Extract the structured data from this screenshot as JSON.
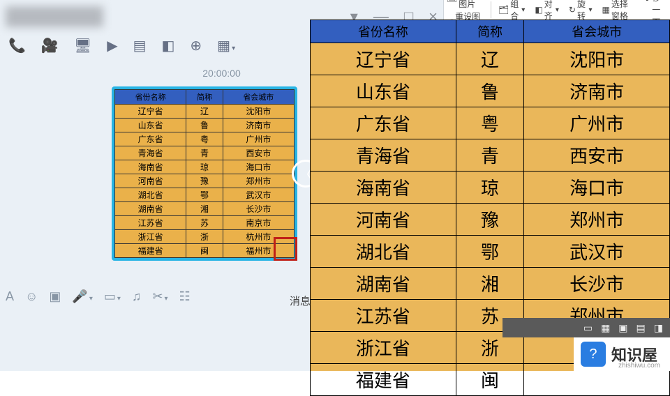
{
  "chat": {
    "user_name": "联系人",
    "window_controls": {
      "dropdown": "▾",
      "min": "—",
      "max": "□",
      "close": "×"
    },
    "toolbar": [
      "phone-icon",
      "video-icon",
      "screen-share-icon",
      "send-file-icon",
      "send-image-icon",
      "app-icon",
      "add-icon",
      "grid-icon"
    ],
    "timestamp": "20:00:00",
    "mini_table": {
      "headers": [
        "省份名称",
        "简称",
        "省会城市"
      ],
      "rows": [
        [
          "辽宁省",
          "辽",
          "沈阳市"
        ],
        [
          "山东省",
          "鲁",
          "济南市"
        ],
        [
          "广东省",
          "粤",
          "广州市"
        ],
        [
          "青海省",
          "青",
          "西安市"
        ],
        [
          "海南省",
          "琼",
          "海口市"
        ],
        [
          "河南省",
          "豫",
          "郑州市"
        ],
        [
          "湖北省",
          "鄂",
          "武汉市"
        ],
        [
          "湖南省",
          "湘",
          "长沙市"
        ],
        [
          "江苏省",
          "苏",
          "南京市"
        ],
        [
          "浙江省",
          "浙",
          "杭州市"
        ],
        [
          "福建省",
          "闽",
          "福州市"
        ]
      ]
    },
    "input_bar": [
      "font-icon",
      "emoji-icon",
      "image-icon",
      "mic-icon",
      "screenshot-icon",
      "music-icon",
      "cut-icon",
      "history-icon"
    ],
    "msg_label": "消息"
  },
  "ribbon": [
    {
      "icon": "🖼",
      "label": "更改图片",
      "caret": true
    },
    {
      "icon": "↺",
      "label": "重设图片"
    },
    {
      "icon": "🗂",
      "label": "组合",
      "caret": true
    },
    {
      "icon": "◧",
      "label": "对齐",
      "caret": true
    },
    {
      "icon": "↻",
      "label": "旋转",
      "caret": true
    },
    {
      "icon": "▦",
      "label": "选择窗格"
    },
    {
      "icon": "⬆",
      "label": "上移一"
    },
    {
      "icon": "⬇",
      "label": "下移"
    }
  ],
  "big_table": {
    "headers": [
      "省份名称",
      "简称",
      "省会城市"
    ],
    "rows": [
      [
        "辽宁省",
        "辽",
        "沈阳市"
      ],
      [
        "山东省",
        "鲁",
        "济南市"
      ],
      [
        "广东省",
        "粤",
        "广州市"
      ],
      [
        "青海省",
        "青",
        "西安市"
      ],
      [
        "海南省",
        "琼",
        "海口市"
      ],
      [
        "河南省",
        "豫",
        "郑州市"
      ],
      [
        "湖北省",
        "鄂",
        "武汉市"
      ],
      [
        "湖南省",
        "湘",
        "长沙市"
      ],
      [
        "江苏省",
        "苏",
        "郑州市"
      ],
      [
        "浙江省",
        "浙",
        ""
      ],
      [
        "福建省",
        "闽",
        ""
      ]
    ]
  },
  "brand": {
    "name": "知识屋",
    "url": "zhishiwu.com",
    "glyph": "?"
  },
  "pptbar": [
    "▭",
    "▦",
    "▣",
    "▤",
    "◨"
  ]
}
